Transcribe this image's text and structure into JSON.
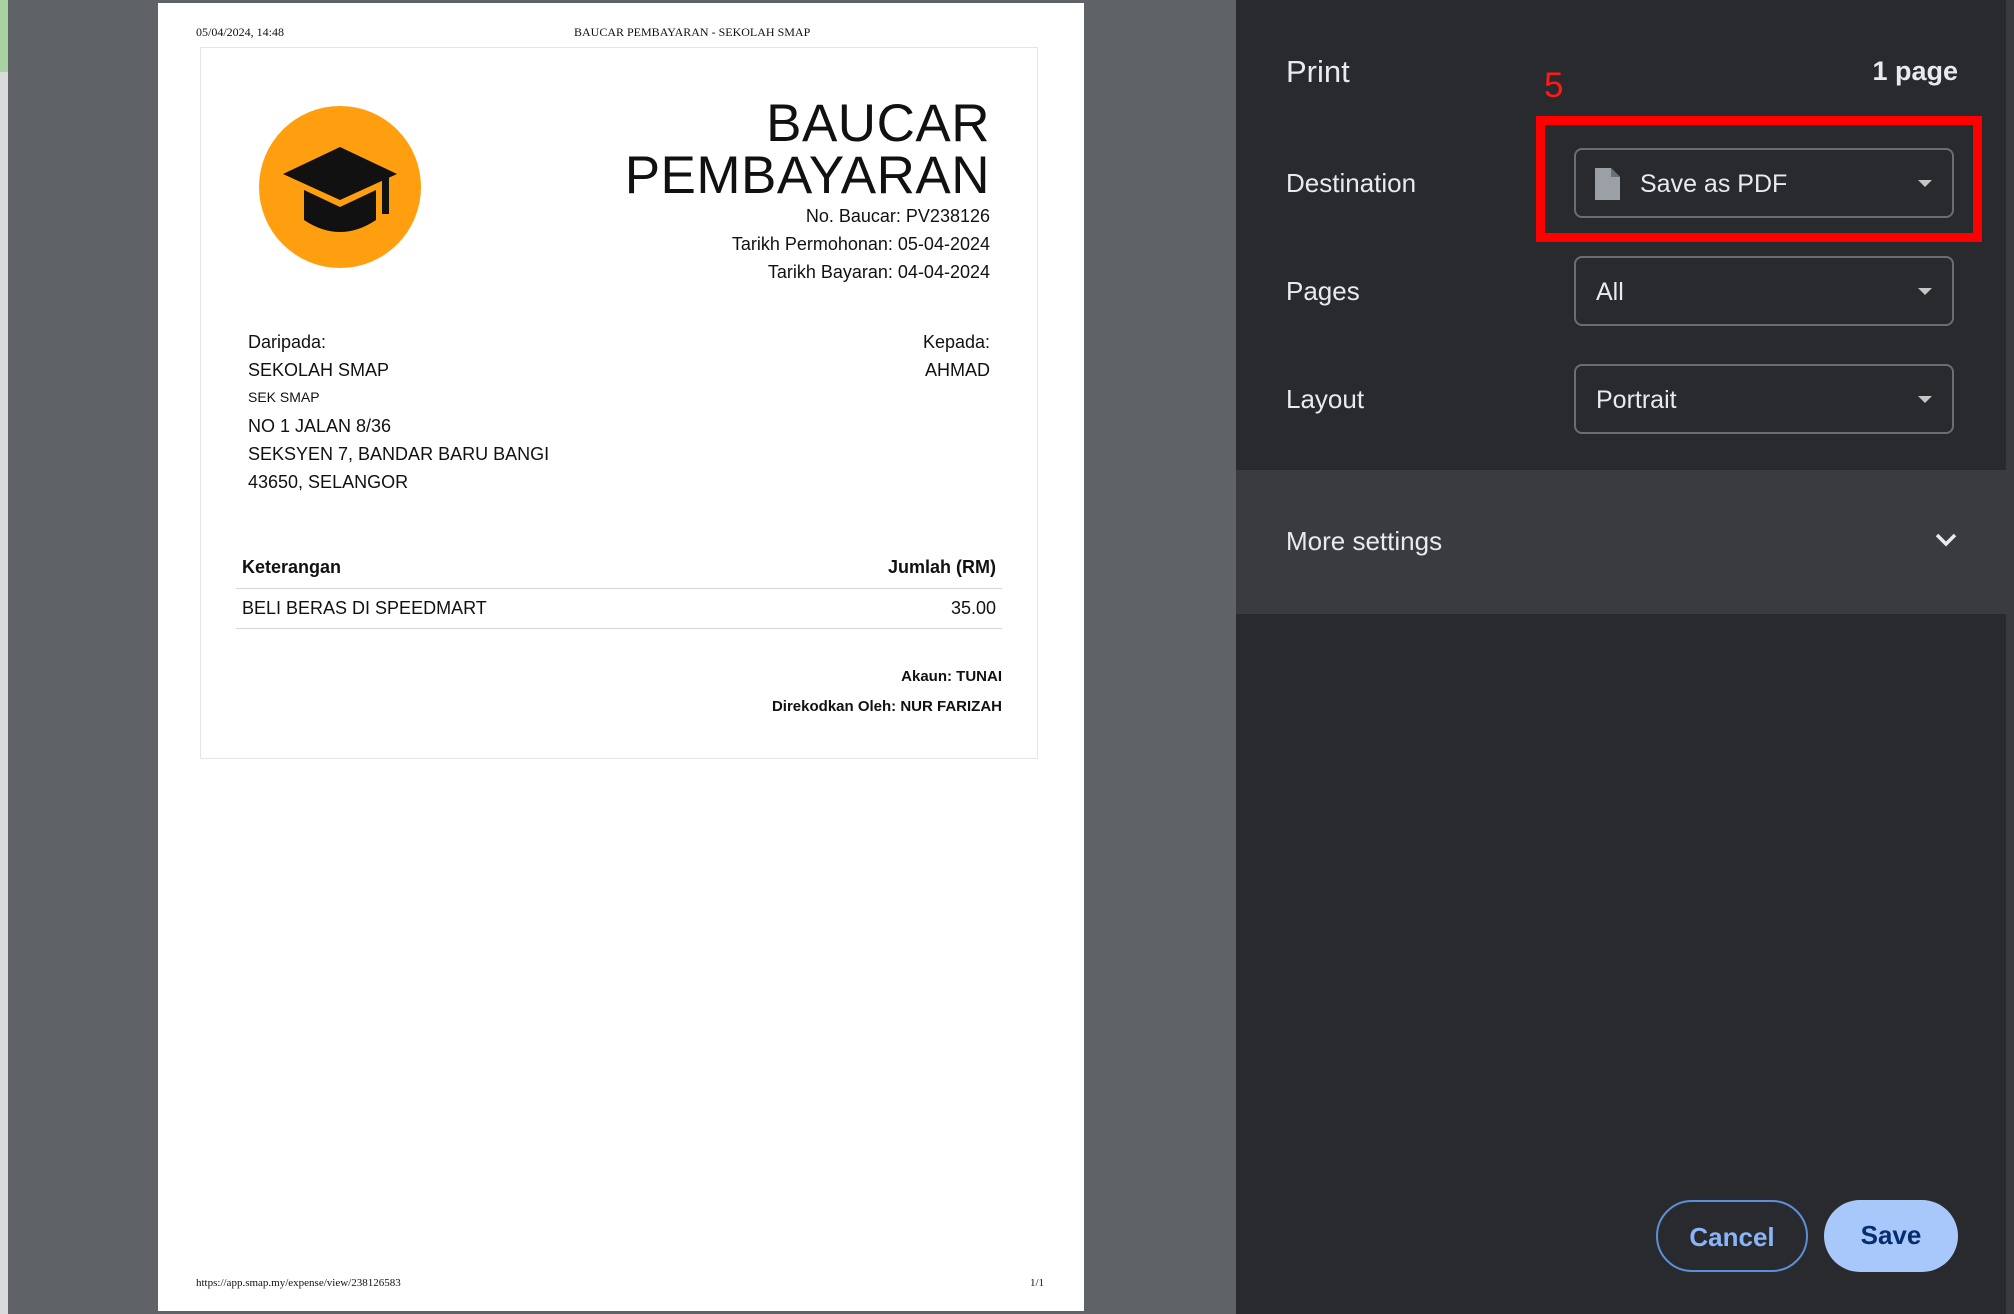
{
  "preview": {
    "header_datetime": "05/04/2024, 14:48",
    "header_title": "BAUCAR PEMBAYARAN - SEKOLAH SMAP",
    "footer_url": "https://app.smap.my/expense/view/238126583",
    "footer_page": "1/1",
    "voucher": {
      "title_line1": "BAUCAR",
      "title_line2": "PEMBAYARAN",
      "voucher_no": "No. Baucar: PV238126",
      "request_date": "Tarikh Permohonan: 05-04-2024",
      "payment_date": "Tarikh Bayaran: 04-04-2024",
      "from_label": "Daripada:",
      "from_name": "SEKOLAH SMAP",
      "from_short": "SEK SMAP",
      "from_address1": "NO 1 JALAN 8/36",
      "from_address2": "SEKSYEN 7, BANDAR BARU BANGI",
      "from_address3": "43650, SELANGOR",
      "to_label": "Kepada:",
      "to_name": "AHMAD",
      "table_header_desc": "Keterangan",
      "table_header_amount": "Jumlah (RM)",
      "rows": [
        {
          "desc": "BELI BERAS DI SPEEDMART",
          "amount": "35.00"
        }
      ],
      "account": "Akaun: TUNAI",
      "recorded_by": "Direkodkan Oleh: NUR FARIZAH",
      "logo_icon": "graduation-cap-icon",
      "logo_color": "#ff9f0f"
    }
  },
  "panel": {
    "title": "Print",
    "page_count": "1 page",
    "annotation_number": "5",
    "destination_label": "Destination",
    "destination_value": "Save as PDF",
    "pages_label": "Pages",
    "pages_value": "All",
    "layout_label": "Layout",
    "layout_value": "Portrait",
    "more_settings": "More settings",
    "cancel": "Cancel",
    "save": "Save",
    "highlight_color": "#ff0000"
  }
}
